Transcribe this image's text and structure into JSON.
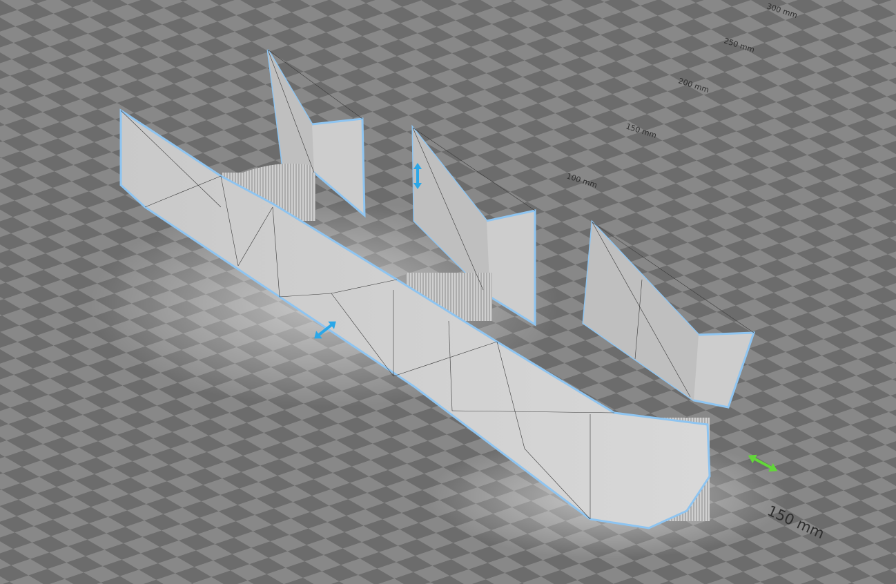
{
  "viewport": {
    "ruler_labels": [
      "300 mm",
      "250 mm",
      "200 mm",
      "150 mm",
      "100 mm"
    ],
    "dimension_label": "150 mm"
  },
  "colors": {
    "bed_light": "#8a8a8a",
    "bed_dark": "#6a6a6a",
    "model_fill": "#d3d3d3",
    "model_shade": "#bdbdbd",
    "selection_outline": "#8ec4f0",
    "gizmo_blue": "#2aa7e8",
    "gizmo_green": "#63d63a"
  },
  "icons": {
    "move_handle_blue": "double-arrow-icon",
    "scale_handle_green": "double-arrow-icon"
  }
}
